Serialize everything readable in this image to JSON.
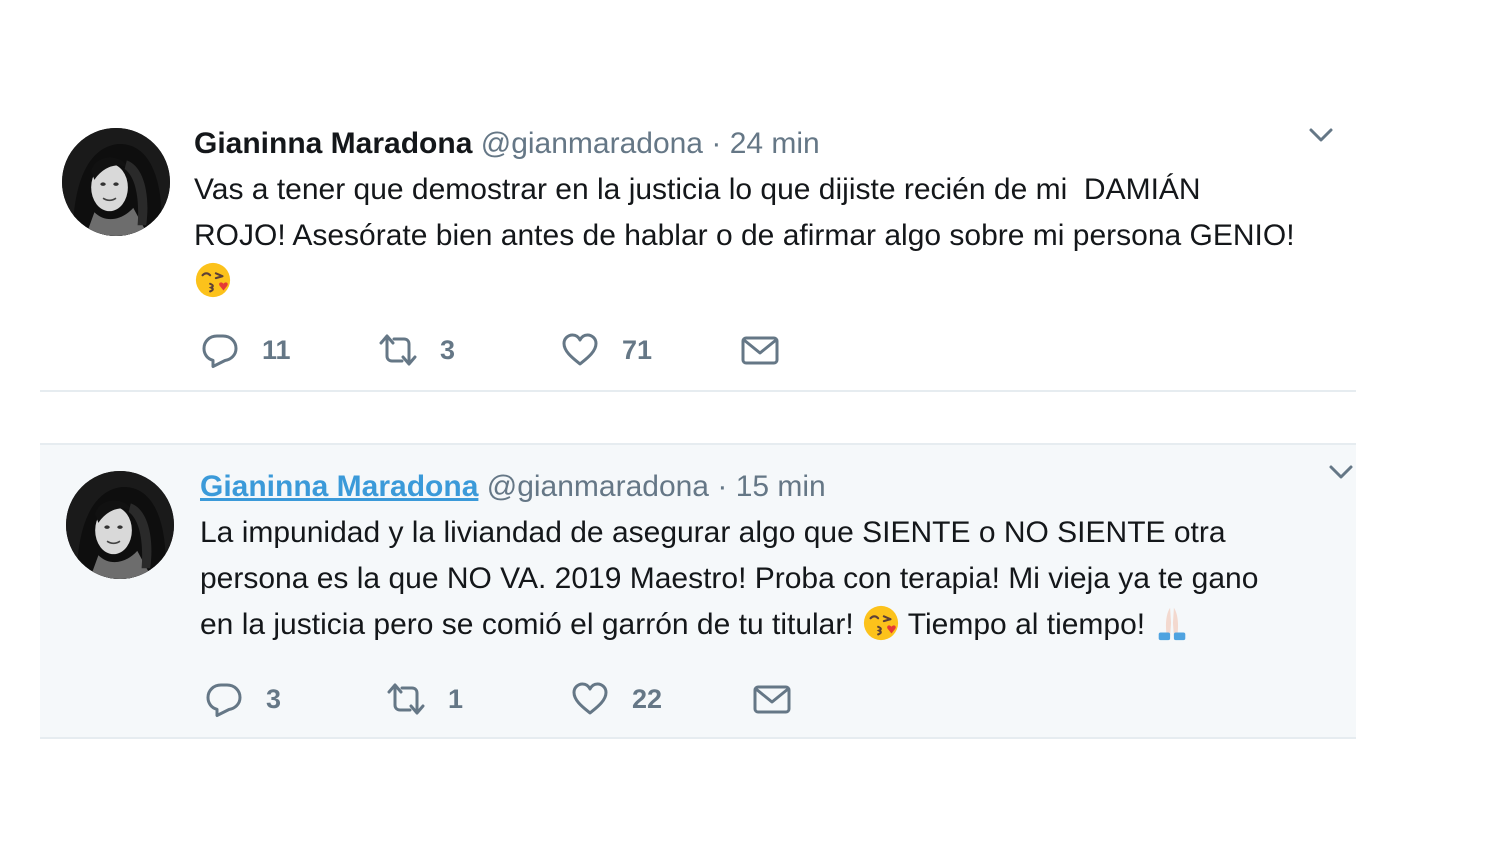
{
  "tweets": [
    {
      "name": "Gianinna Maradona",
      "handle": "@gianmaradona",
      "separator": "·",
      "time": "24 min",
      "text_lines": [
        "Vas a tener que demostrar en la justicia lo que dijiste recién de mi  DAMIÁN",
        "ROJO! Asesórate bien antes de hablar o de afirmar algo sobre mi persona GENIO!"
      ],
      "emojis": [
        "face-blowing-kiss-emoji"
      ],
      "replies": "11",
      "retweets": "3",
      "likes": "71"
    },
    {
      "name": "Gianinna Maradona",
      "handle": "@gianmaradona",
      "separator": "·",
      "time": "15 min",
      "text_line_1": "La impunidad y la liviandad de asegurar algo que SIENTE o NO SIENTE otra",
      "text_line_2": "persona es la que NO VA. 2019 Maestro! Proba con terapia! Mi vieja ya te gano",
      "text_line_3a": "en la justicia pero se comió el garrón de tu titular! ",
      "text_line_3b": " Tiempo al tiempo! ",
      "emojis": [
        "face-blowing-kiss-emoji",
        "folded-hands-emoji"
      ],
      "replies": "3",
      "retweets": "1",
      "likes": "22"
    }
  ],
  "icons": {
    "reply": "reply-icon",
    "retweet": "retweet-icon",
    "like": "heart-icon",
    "dm": "envelope-icon",
    "caret": "chevron-down-icon"
  },
  "colors": {
    "name_link": "#3b9ad9",
    "meta_gray": "#657786",
    "highlight_bg": "#f5f8fa",
    "border": "#e6ecf0"
  }
}
